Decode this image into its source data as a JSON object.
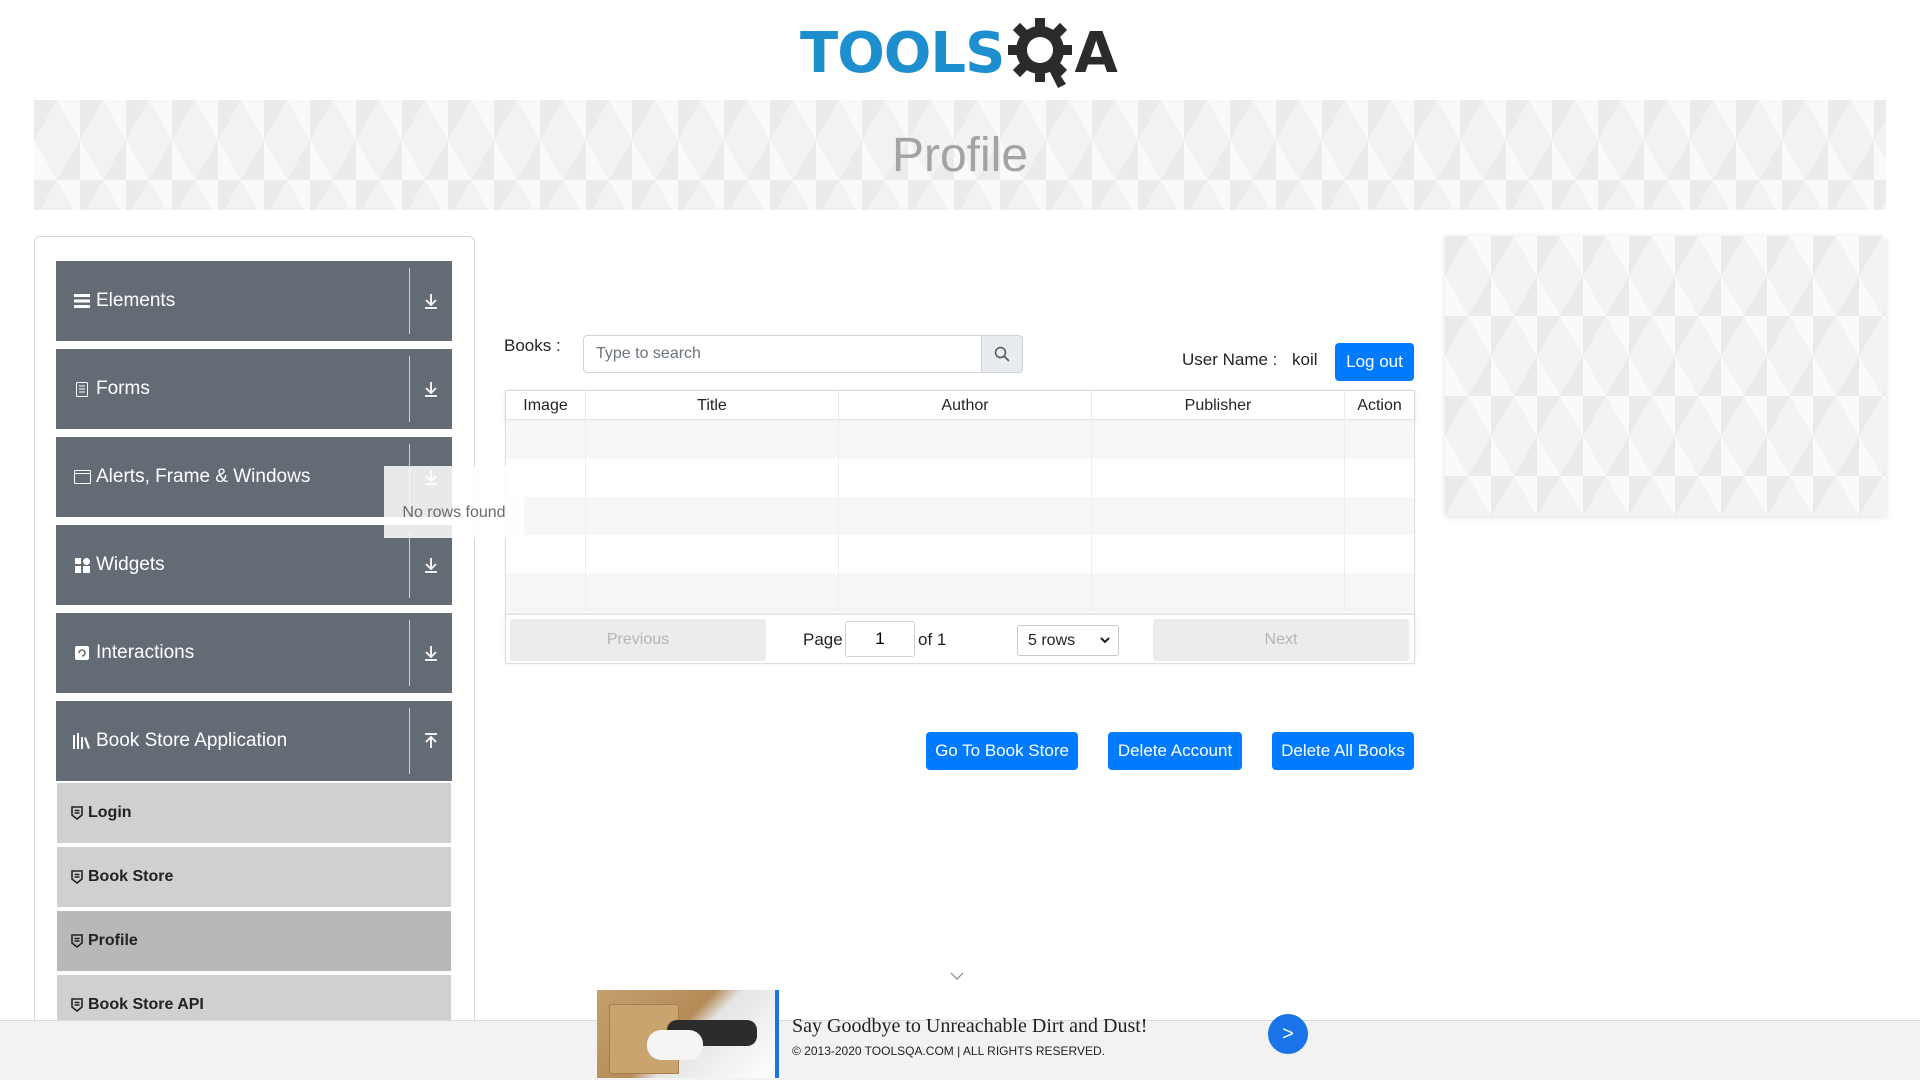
{
  "logo": {
    "tools": "TOOLS",
    "qa_tail": "A"
  },
  "banner": {
    "title": "Profile"
  },
  "sidebar": {
    "groups": [
      {
        "label": "Elements",
        "icon": "menu-icon",
        "expanded": false
      },
      {
        "label": "Forms",
        "icon": "document-icon",
        "expanded": false
      },
      {
        "label": "Alerts, Frame & Windows",
        "icon": "window-icon",
        "expanded": false
      },
      {
        "label": "Widgets",
        "icon": "widgets-icon",
        "expanded": false
      },
      {
        "label": "Interactions",
        "icon": "interactions-icon",
        "expanded": false
      },
      {
        "label": "Book Store Application",
        "icon": "library-icon",
        "expanded": true
      }
    ],
    "subitems": [
      {
        "label": "Login",
        "active": false
      },
      {
        "label": "Book Store",
        "active": false
      },
      {
        "label": "Profile",
        "active": true
      },
      {
        "label": "Book Store API",
        "active": false
      }
    ]
  },
  "main": {
    "books_label": "Books :",
    "search": {
      "placeholder": "Type to search",
      "value": ""
    },
    "user": {
      "label": "User Name :",
      "value": "koil"
    },
    "logout_label": "Log out",
    "table": {
      "columns": [
        "Image",
        "Title",
        "Author",
        "Publisher",
        "Action"
      ],
      "empty_text": "No rows found"
    },
    "pagination": {
      "previous": "Previous",
      "next": "Next",
      "page_label": "Page",
      "page_value": "1",
      "of_label": "of 1",
      "rows_selected": "5 rows"
    },
    "actions": {
      "goto_store": "Go To Book Store",
      "delete_account": "Delete Account",
      "delete_all_books": "Delete All Books"
    }
  },
  "footer": {
    "ad_title": "Say Goodbye to Unreachable Dirt and Dust!",
    "copyright": "© 2013-2020 TOOLSQA.COM | ALL RIGHTS RESERVED.",
    "ad_arrow": ">"
  },
  "colors": {
    "primary": "#007bff",
    "sidebar_header": "#636b75",
    "logo_blue": "#1d8fcf"
  }
}
